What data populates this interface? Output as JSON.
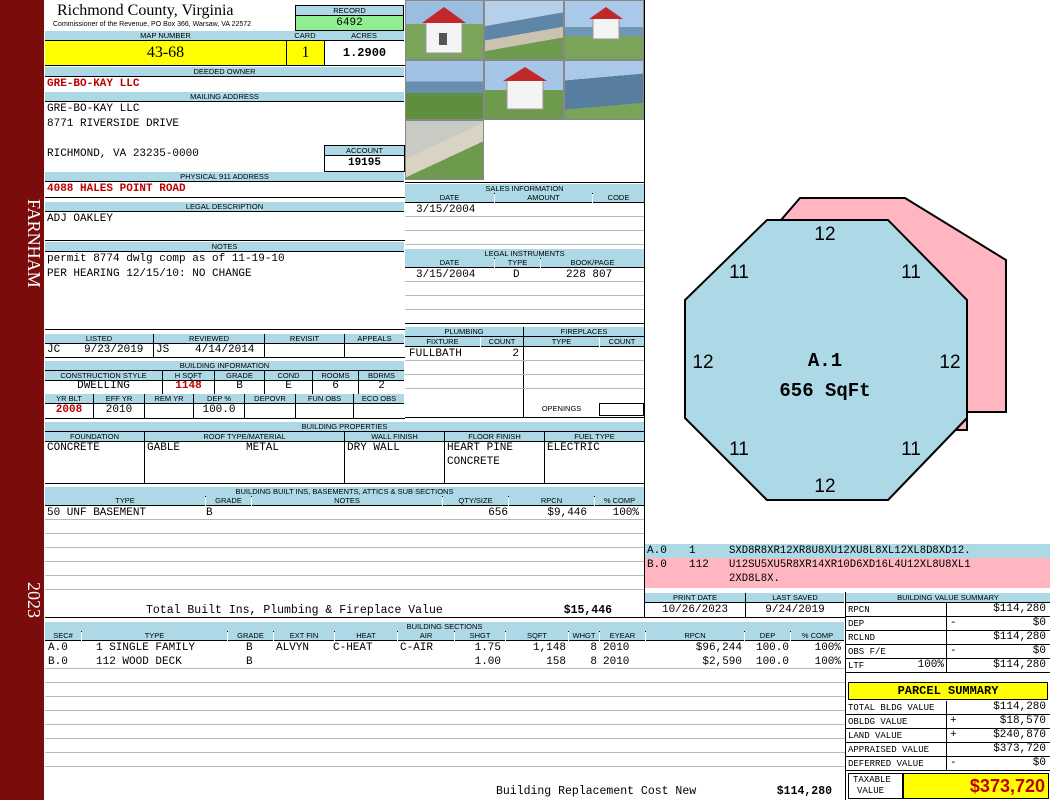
{
  "side": {
    "district": "FARNHAM",
    "year": "2023"
  },
  "header": {
    "county": "Richmond County, Virginia",
    "commissioner": "Commissioner of the Revenue, PO Box 366, Warsaw, VA 22572",
    "record_label": "RECORD",
    "record": "6492",
    "map_label": "MAP NUMBER",
    "map_number": "43-68",
    "card_label": "CARD",
    "card": "1",
    "acres_label": "ACRES",
    "acres": "1.2900"
  },
  "owner": {
    "deeded_label": "DEEDED OWNER",
    "deeded": "GRE-BO-KAY LLC",
    "mailing_label": "MAILING ADDRESS",
    "mailing": [
      "GRE-BO-KAY LLC",
      "8771 RIVERSIDE DRIVE",
      "",
      "RICHMOND, VA 23235-0000"
    ],
    "account_label": "ACCOUNT",
    "account": "19195",
    "physical_label": "PHYSICAL 911 ADDRESS",
    "physical": "4088 HALES POINT ROAD",
    "legal_label": "LEGAL DESCRIPTION",
    "legal": "ADJ OAKLEY",
    "notes_label": "NOTES",
    "notes": [
      "permit 8774 dwlg comp as of 11-19-10",
      "PER HEARING 12/15/10: NO CHANGE"
    ]
  },
  "review": {
    "listed_label": "LISTED",
    "reviewed_label": "REVIEWED",
    "revisit_label": "REVISIT",
    "appeals_label": "APPEALS",
    "listed_by": "JC",
    "listed_date": "9/23/2019",
    "reviewed_by": "JS",
    "reviewed_date": "4/14/2014"
  },
  "building_info": {
    "title": "BUILDING INFORMATION",
    "h": [
      "CONSTRUCTION STYLE",
      "H SQFT",
      "GRADE",
      "COND",
      "ROOMS",
      "BDRMS"
    ],
    "v": [
      "DWELLING",
      "1148",
      "B",
      "E",
      "6",
      "2"
    ],
    "h2": [
      "YR BLT",
      "EFF YR",
      "REM YR",
      "DEP %",
      "DEPOVR",
      "FUN OBS",
      "ECO OBS"
    ],
    "v2": [
      "2008",
      "2010",
      "",
      "100.0",
      "",
      "",
      ""
    ]
  },
  "sales": {
    "title": "SALES INFORMATION",
    "h": [
      "DATE",
      "AMOUNT",
      "CODE"
    ],
    "rows": [
      [
        "3/15/2004",
        "",
        ""
      ]
    ]
  },
  "legal_instruments": {
    "title": "LEGAL INSTRUMENTS",
    "h": [
      "DATE",
      "TYPE",
      "BOOK/PAGE"
    ],
    "rows": [
      [
        "3/15/2004",
        "D",
        "228 807"
      ]
    ]
  },
  "plumbing": {
    "title": "PLUMBING",
    "h": [
      "FIXTURE",
      "COUNT"
    ],
    "fixture": "FULLBATH",
    "count": "2"
  },
  "fireplaces": {
    "title": "FIREPLACES",
    "h": [
      "TYPE",
      "COUNT"
    ],
    "openings_label": "OPENINGS"
  },
  "properties": {
    "title": "BUILDING PROPERTIES",
    "h": [
      "FOUNDATION",
      "ROOF TYPE/MATERIAL",
      "WALL FINISH",
      "FLOOR FINISH",
      "FUEL TYPE"
    ],
    "foundation": "CONCRETE",
    "roof_type": "GABLE",
    "roof_material": "METAL",
    "wall": "DRY WALL",
    "floor1": "HEART PINE",
    "floor2": "CONCRETE",
    "fuel": "ELECTRIC"
  },
  "builtins": {
    "title": "BUILDING BUILT INS, BASEMENTS, ATTICS & SUB SECTIONS",
    "h": [
      "TYPE",
      "GRADE",
      "NOTES",
      "QTY/SIZE",
      "RPCN",
      "% COMP"
    ],
    "row": [
      "50 UNF BASEMENT",
      "B",
      "",
      "656",
      "$9,446",
      "100%"
    ],
    "total_label": "Total Built Ins, Plumbing & Fireplace Value",
    "total": "$15,446"
  },
  "sections": {
    "title": "BUILDING SECTIONS",
    "h": [
      "SEC#",
      "TYPE",
      "GRADE",
      "EXT FIN",
      "HEAT",
      "AIR",
      "SHGT",
      "SQFT",
      "WHGT",
      "EYEAR",
      "RPCN",
      "DEP",
      "% COMP"
    ],
    "rows": [
      [
        "A.0",
        "1 SINGLE FAMILY",
        "B",
        "ALVYN",
        "C-HEAT",
        "C-AIR",
        "1.75",
        "1,148",
        "8",
        "2010",
        "$96,244",
        "100.0",
        "100%"
      ],
      [
        "B.0",
        "112 WOOD DECK",
        "B",
        "",
        "",
        "",
        "1.00",
        "158",
        "8",
        "2010",
        "$2,590",
        "100.0",
        "100%"
      ]
    ],
    "replacement_label": "Building Replacement Cost New",
    "replacement": "$114,280"
  },
  "sketch": {
    "label_main": "A.1",
    "label_area": "656 SqFt",
    "dims": [
      "12",
      "11",
      "11",
      "12",
      "12",
      "11",
      "11",
      "12"
    ],
    "codes": [
      {
        "sec": "A.0",
        "num": "1",
        "code": "SXD8R8XR12XR8U8XU12XU8L8XL12XL8D8XD12."
      },
      {
        "sec": "B.0",
        "num": "112",
        "code": "U12SU5XU5R8XR14XR10D6XD16L4U12XL8U8XL1",
        "code2": "2XD8L8X."
      }
    ],
    "fill_main": "#add8e6",
    "fill_deck": "#ffb6c1"
  },
  "dates": {
    "print_label": "PRINT DATE",
    "print": "10/26/2023",
    "saved_label": "LAST SAVED",
    "saved": "9/24/2019"
  },
  "value_summary": {
    "title": "BUILDING VALUE SUMMARY",
    "rows": [
      {
        "label": "RPCN",
        "sign": "",
        "pct": "",
        "value": "$114,280"
      },
      {
        "label": "DEP",
        "sign": "-",
        "pct": "",
        "value": "$0"
      },
      {
        "label": "RCLND",
        "sign": "",
        "pct": "",
        "value": "$114,280"
      },
      {
        "label": "OBS F/E",
        "sign": "-",
        "pct": "",
        "value": "$0"
      },
      {
        "label": "LTF",
        "sign": "",
        "pct": "100%",
        "value": "$114,280"
      }
    ]
  },
  "parcel": {
    "title": "PARCEL SUMMARY",
    "rows": [
      {
        "label": "TOTAL BLDG VALUE",
        "sign": "",
        "value": "$114,280"
      },
      {
        "label": "OBLDG VALUE",
        "sign": "+",
        "value": "$18,570"
      },
      {
        "label": "LAND VALUE",
        "sign": "+",
        "value": "$240,870"
      },
      {
        "label": "APPRAISED VALUE",
        "sign": "",
        "value": "$373,720"
      },
      {
        "label": "DEFERRED VALUE",
        "sign": "-",
        "value": "$0"
      }
    ],
    "taxable_label1": "TAXABLE",
    "taxable_label2": "VALUE",
    "taxable": "$373,720"
  },
  "colors": {
    "accent": "#add8e6",
    "side": "#7a0c0c",
    "highlight_yellow": "#ffff00",
    "highlight_green": "#90ee90",
    "red_text": "#c00000"
  }
}
